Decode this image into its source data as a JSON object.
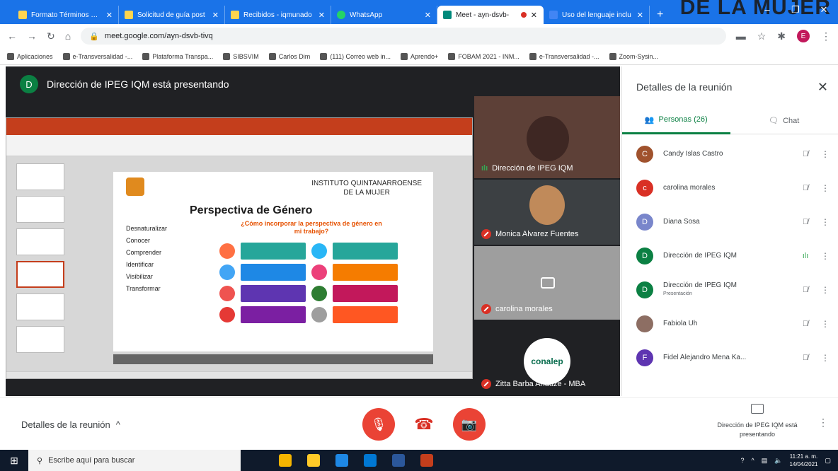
{
  "tabs": [
    {
      "label": "Formato Términos de r",
      "icon": "yellow"
    },
    {
      "label": "Solicitud de guía post",
      "icon": "yellow"
    },
    {
      "label": "Recibidos - iqmunado",
      "icon": "yellow"
    },
    {
      "label": "WhatsApp",
      "icon": "wa"
    },
    {
      "label": "Meet - ayn-dsvb-",
      "icon": "meet",
      "active": true
    },
    {
      "label": "Uso del lenguaje inclu",
      "icon": "doc"
    }
  ],
  "banner_text": "DE LA MUJER",
  "address": {
    "url": "meet.google.com/ayn-dsvb-tivq",
    "profile": "E"
  },
  "bookmarks": [
    "Aplicaciones",
    "e-Transversalidad -...",
    "Plataforma Transpa...",
    "SIBSVIM",
    "Carlos Dim",
    "(111) Correo web in...",
    "Aprendo+",
    "FOBAM 2021 - INM...",
    "e-Transversalidad -...",
    "Zoom-Sysin..."
  ],
  "stage": {
    "presenter_avatar": "D",
    "presenter_text": "Dirección de IPEG IQM está presentando",
    "slide": {
      "title": "Perspectiva de Género",
      "institute": "INSTITUTO QUINTANARROENSE\nDE LA MUJER",
      "question": "¿Cómo incorporar la perspectiva de género en mi trabajo?",
      "bullets": [
        "Desnaturalizar",
        "Conocer",
        "Comprender",
        "Identificar",
        "Visibilizar",
        "Transformar"
      ]
    },
    "tiles": [
      {
        "name": "Dirección de IPEG IQM",
        "state": "speaking"
      },
      {
        "name": "Monica Alvarez Fuentes",
        "state": "muted"
      },
      {
        "name": "carolina morales",
        "state": "muted"
      },
      {
        "name": "Zitta Barba Anduze - MBA",
        "state": "muted",
        "logo": "conalep"
      }
    ]
  },
  "side": {
    "title": "Detalles de la reunión",
    "tab_people": "Personas (26)",
    "tab_chat": "Chat",
    "participants": [
      {
        "initial": "C",
        "color": "#a0522d",
        "name": "Candy Islas Castro",
        "mic": "muted"
      },
      {
        "initial": "c",
        "color": "#d93025",
        "name": "carolina morales",
        "mic": "muted"
      },
      {
        "initial": "D",
        "color": "#7986cb",
        "name": "Diana Sosa",
        "mic": "muted"
      },
      {
        "initial": "D",
        "color": "#0b8043",
        "name": "Dirección de IPEG IQM",
        "mic": "speaking"
      },
      {
        "initial": "D",
        "color": "#0b8043",
        "name": "Dirección de IPEG IQM",
        "sub": "Presentación",
        "mic": "muted"
      },
      {
        "initial": "",
        "color": "#8d6e63",
        "name": "Fabiola Uh",
        "mic": "muted"
      },
      {
        "initial": "F",
        "color": "#5e35b1",
        "name": "Fidel Alejandro Mena Ka...",
        "mic": "muted"
      }
    ]
  },
  "bottom": {
    "details": "Detalles de la reunión",
    "presenting_label": "Dirección de IPEG IQM está presentando"
  },
  "taskbar": {
    "search": "Escribe aquí para buscar",
    "time": "11:21 a. m.",
    "date": "14/04/2021"
  }
}
